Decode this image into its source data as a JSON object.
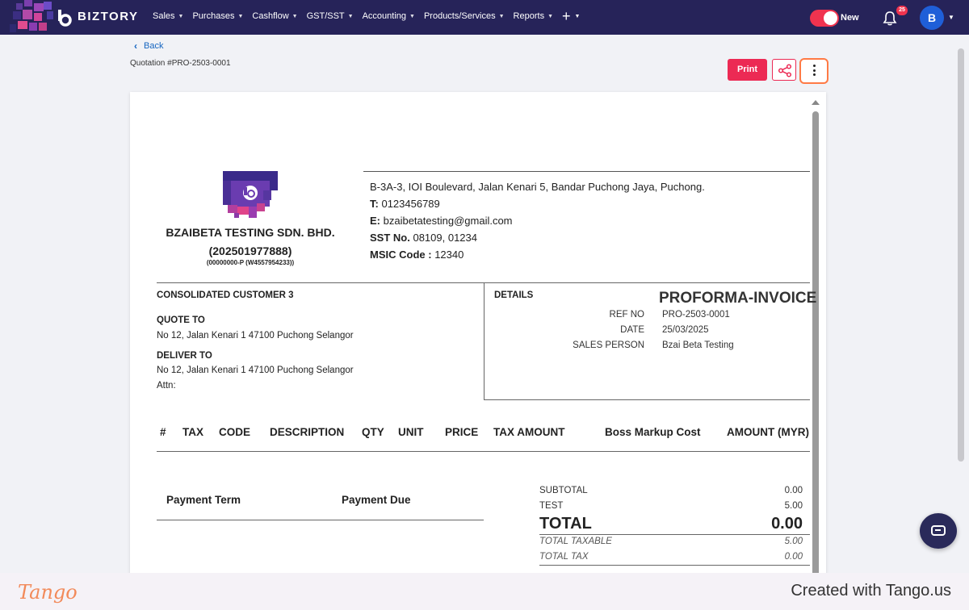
{
  "app": {
    "brand": "BIZTORY",
    "nav": [
      {
        "label": "Sales",
        "has_caret": true
      },
      {
        "label": "Purchases",
        "has_caret": true
      },
      {
        "label": "Cashflow",
        "has_caret": true
      },
      {
        "label": "GST/SST",
        "has_caret": true
      },
      {
        "label": "Accounting",
        "has_caret": true
      },
      {
        "label": "Products/Services",
        "has_caret": true
      },
      {
        "label": "Reports",
        "has_caret": true
      }
    ],
    "plus_icon": "+",
    "toggle_label": "New",
    "notification_count": "25",
    "avatar_initial": "B",
    "colors": {
      "nav_bg": "#262359",
      "accent": "#ec2a54",
      "link": "#1565c0",
      "highlight": "#ff7a45"
    }
  },
  "page": {
    "back_label": "Back",
    "quotation_title": "Quotation #PRO-2503-0001",
    "print_label": "Print",
    "share_icon": "share-icon",
    "more_icon": "more-vertical-icon"
  },
  "document": {
    "company": {
      "name": "BZAIBETA TESTING SDN. BHD.",
      "reg_no": "(202501977888)",
      "old_reg": "(00000000-P (W4557954233))",
      "address": "B-3A-3, IOI Boulevard, Jalan Kenari 5, Bandar Puchong Jaya, Puchong.",
      "phone_label": "T:",
      "phone": "0123456789",
      "email_label": "E:",
      "email": "bzaibetatesting@gmail.com",
      "sst_label": "SST No.",
      "sst": "08109, 01234",
      "msic_label": "MSIC Code :",
      "msic": "12340"
    },
    "customer": {
      "name": "CONSOLIDATED CUSTOMER 3",
      "quote_to_label": "QUOTE TO",
      "quote_to_address": "No 12, Jalan Kenari 1 47100 Puchong Selangor",
      "deliver_to_label": "DELIVER TO",
      "deliver_to_address": "No 12, Jalan Kenari 1 47100 Puchong Selangor",
      "attn": "Attn:"
    },
    "details": {
      "label": "DETAILS",
      "doc_type": "PROFORMA-INVOICE",
      "ref_no_label": "REF NO",
      "ref_no": "PRO-2503-0001",
      "date_label": "DATE",
      "date": "25/03/2025",
      "sales_person_label": "SALES PERSON",
      "sales_person": "Bzai Beta Testing"
    },
    "item_columns": [
      "#",
      "TAX",
      "CODE",
      "DESCRIPTION",
      "QTY",
      "UNIT",
      "PRICE",
      "TAX AMOUNT",
      "Boss Markup Cost",
      "AMOUNT (MYR)"
    ],
    "payment": {
      "term_label": "Payment Term",
      "due_label": "Payment Due"
    },
    "totals": {
      "subtotal_label": "SUBTOTAL",
      "subtotal": "0.00",
      "test_label": "TEST",
      "test": "5.00",
      "total_label": "TOTAL",
      "total": "0.00",
      "taxable_label": "TOTAL TAXABLE",
      "taxable": "5.00",
      "tax_label": "TOTAL TAX",
      "tax": "0.00"
    }
  },
  "footer": {
    "tango": "Tango",
    "created": "Created with Tango.us"
  }
}
